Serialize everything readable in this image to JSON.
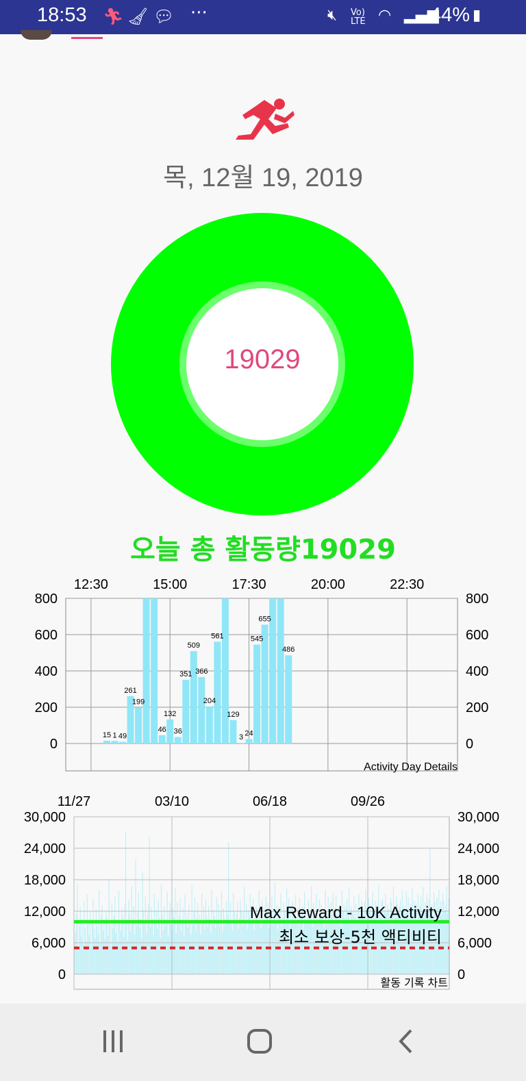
{
  "status_bar": {
    "time": "18:53",
    "battery": "44%",
    "overflow": "···"
  },
  "header": {
    "date": "목, 12월 19, 2019",
    "steps_center": "19029",
    "total_label": "오늘 총 활동량19029"
  },
  "colors": {
    "ring": "#00ff00",
    "count_text": "#e0487d",
    "bar_day": "#8fe6f7",
    "bar_history": "#c2f0f7",
    "max_line": "#22ee22",
    "min_line": "#dd2222",
    "status_bar": "#2c3592"
  },
  "day_chart": {
    "title": "Activity Day Details",
    "x_tick_labels": [
      "12:30",
      "15:00",
      "17:30",
      "20:00",
      "22:30"
    ],
    "y_tick_labels": [
      "800",
      "600",
      "400",
      "200",
      "0"
    ]
  },
  "history_chart": {
    "title": "활동 기록 차트",
    "x_tick_labels": [
      "11/27",
      "03/10",
      "06/18",
      "09/26"
    ],
    "y_tick_labels": [
      "30,000",
      "24,000",
      "18,000",
      "12,000",
      "6,000",
      "0"
    ],
    "max_label": "Max Reward - 10K Activity",
    "min_label": "최소 보상-5천 액티비티"
  },
  "chart_data": [
    {
      "type": "bar",
      "title": "Activity Day Details",
      "x_tick_labels": [
        "12:30",
        "15:00",
        "17:30",
        "20:00",
        "22:30"
      ],
      "ylim": [
        0,
        800
      ],
      "y_ticks": [
        0,
        200,
        400,
        600,
        800
      ],
      "grid": true,
      "bars": [
        {
          "t": 13.0,
          "value": 15,
          "label": "15"
        },
        {
          "t": 13.25,
          "value": 14,
          "label": "1"
        },
        {
          "t": 13.5,
          "value": 9,
          "label": "49"
        },
        {
          "t": 13.75,
          "value": 261,
          "label": "261"
        },
        {
          "t": 14.0,
          "value": 199,
          "label": "199"
        },
        {
          "t": 14.25,
          "value": 900,
          "label": ""
        },
        {
          "t": 14.5,
          "value": 900,
          "label": ""
        },
        {
          "t": 14.75,
          "value": 46,
          "label": "46"
        },
        {
          "t": 15.0,
          "value": 132,
          "label": "132"
        },
        {
          "t": 15.25,
          "value": 36,
          "label": "36"
        },
        {
          "t": 15.5,
          "value": 351,
          "label": "351"
        },
        {
          "t": 15.75,
          "value": 509,
          "label": "509"
        },
        {
          "t": 16.0,
          "value": 366,
          "label": "366"
        },
        {
          "t": 16.25,
          "value": 204,
          "label": "204"
        },
        {
          "t": 16.5,
          "value": 561,
          "label": "561"
        },
        {
          "t": 16.75,
          "value": 900,
          "label": ""
        },
        {
          "t": 17.0,
          "value": 129,
          "label": "129"
        },
        {
          "t": 17.25,
          "value": 3,
          "label": "3"
        },
        {
          "t": 17.5,
          "value": 24,
          "label": "24"
        },
        {
          "t": 17.75,
          "value": 545,
          "label": "545"
        },
        {
          "t": 18.0,
          "value": 655,
          "label": "655"
        },
        {
          "t": 18.25,
          "value": 900,
          "label": ""
        },
        {
          "t": 18.5,
          "value": 900,
          "label": ""
        },
        {
          "t": 18.75,
          "value": 486,
          "label": "486"
        }
      ]
    },
    {
      "type": "bar",
      "title": "활동 기록 차트",
      "x_tick_labels": [
        "11/27",
        "03/10",
        "06/18",
        "09/26"
      ],
      "ylim": [
        0,
        30000
      ],
      "y_ticks": [
        0,
        6000,
        12000,
        18000,
        24000,
        30000
      ],
      "grid": true,
      "reference_lines": [
        {
          "name": "Max Reward - 10K Activity",
          "value": 10000,
          "style": "solid"
        },
        {
          "name": "최소 보상-5천 액티비티",
          "value": 5000,
          "style": "dashed"
        }
      ],
      "daily_values_approx": [
        6200,
        8000,
        11500,
        17200,
        4500,
        9300,
        12800,
        7100,
        10400,
        5600,
        13900,
        8800,
        6300,
        15200,
        9700,
        7400,
        11900,
        5200,
        10100,
        14300,
        8600,
        6900,
        12400,
        9100,
        7700,
        16100,
        5900,
        11200,
        13100,
        8300,
        9900,
        6600,
        12100,
        10800,
        7300,
        18200,
        9400,
        5400,
        13600,
        8700,
        11100,
        14900,
        7900,
        10300,
        6100,
        15900,
        9600,
        8200,
        12600,
        10900,
        7100,
        13300,
        27200,
        9800,
        6400,
        14200,
        11600,
        8100,
        16800,
        10200,
        12900,
        7600,
        21900,
        9300,
        11800,
        15600,
        8900,
        10600,
        6800,
        19300,
        12200,
        9700,
        14800,
        7900,
        11300,
        13400,
        26200,
        9000,
        12700,
        10500,
        7400,
        15300,
        9900,
        12300,
        8600,
        14100,
        10700,
        6900,
        17100,
        11500,
        8300,
        12900,
        9200,
        10100,
        15700,
        7300,
        11900,
        13600,
        9500,
        8400,
        12500,
        10800,
        16400,
        7800,
        13900,
        9600,
        11100,
        14400,
        8100,
        10400,
        12700,
        7200,
        15100,
        9800,
        11600,
        8900,
        13200,
        10300,
        7500,
        16900,
        9300,
        12100,
        14600,
        8200,
        10900,
        13500,
        9700,
        11400,
        7600,
        15400,
        10000,
        12800,
        8500,
        14300,
        11200,
        9000,
        13000,
        10500,
        7900,
        16200,
        9400,
        12400,
        11000,
        8800,
        14700,
        10200,
        13300,
        9100,
        11800,
        15800,
        8000,
        12600,
        10700,
        9300,
        14000,
        11300,
        25000,
        9900,
        13700,
        10400,
        8300,
        15500,
        12000,
        9600,
        11500,
        13800,
        8700,
        10600,
        14200,
        12200,
        9200,
        11700,
        16600,
        10100,
        13400,
        8600,
        12300,
        10900,
        15200,
        9500,
        11900,
        14500,
        8400,
        10800,
        13100,
        12500,
        9700,
        16000,
        11100,
        8900,
        14100,
        10300,
        12700,
        9800,
        15000,
        11400,
        13600,
        8700,
        10500,
        12000,
        14800,
        9400,
        11800,
        17500,
        10000,
        13200,
        8500,
        12900,
        11200,
        15400,
        9100,
        10700,
        13700,
        12100,
        9600,
        16300,
        11000,
        14400,
        8800,
        12600,
        10400,
        13900,
        9900,
        11600,
        15100,
        10200,
        12800,
        9300,
        14600,
        11300,
        10900,
        13000,
        8600,
        15700,
        12200,
        9700,
        11500,
        14000,
        10600,
        12400,
        16800,
        9000,
        13500,
        11700,
        10300,
        15300,
        12000,
        9800,
        14200,
        11100,
        13300,
        10800,
        12500,
        8900,
        16100,
        11900,
        10100,
        14700,
        12300,
        9500,
        13800,
        11400,
        15500,
        10000,
        12700,
        14900,
        11600,
        10500,
        13100,
        12100,
        9200,
        15900,
        11800,
        13600,
        10700,
        12900,
        14300,
        11000,
        16500,
        10200,
        13000,
        12200,
        11500,
        14800,
        10900,
        13400,
        9600,
        12600,
        15200,
        11300,
        10600,
        14100,
        12800,
        11100,
        13700,
        16200,
        10400,
        12300,
        14500,
        11900,
        13200,
        10800,
        15600,
        12400,
        11700,
        14000,
        13100,
        10300,
        16900,
        12700,
        11200,
        13900,
        14400,
        10100,
        12000,
        15400,
        11600,
        13300,
        12500,
        10700,
        14600,
        13800,
        11400,
        16700,
        12200,
        10900,
        15000,
        13500,
        11800,
        12900,
        14200,
        11000,
        16000,
        12600,
        13100,
        11500,
        15800,
        12100,
        14700,
        10600,
        13400,
        12300,
        16300,
        11900,
        14100,
        12800,
        13600,
        10500,
        15100,
        12400,
        13000,
        14900,
        11200,
        16600,
        12000,
        13700,
        11700,
        15200,
        12900,
        14300,
        23900,
        12500,
        13300,
        11100,
        15600,
        13800,
        12200,
        14600,
        10800,
        16100,
        12700,
        13900,
        11300,
        15400,
        14000,
        12100,
        13200,
        16800,
        11600,
        14500
      ]
    }
  ]
}
